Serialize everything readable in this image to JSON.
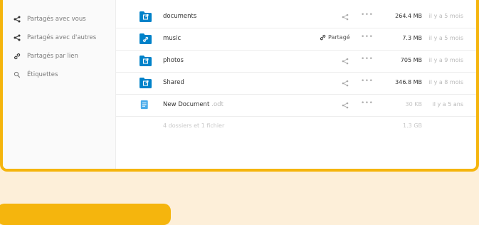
{
  "sidebar": {
    "items": [
      {
        "label": "Partagés avec vous",
        "icon": "share-icon"
      },
      {
        "label": "Partagés avec d'autres",
        "icon": "share-icon"
      },
      {
        "label": "Partagés par lien",
        "icon": "link-icon"
      },
      {
        "label": "Étiquettes",
        "icon": "tag-search-icon"
      }
    ]
  },
  "files": [
    {
      "name": "documents",
      "ext": "",
      "icon": "folder-external-icon",
      "shared_label": "",
      "size": "264.4 MB",
      "modified": "il y a 5 mois"
    },
    {
      "name": "music",
      "ext": "",
      "icon": "folder-link-icon",
      "shared_label": "Partagé",
      "size": "7.3 MB",
      "modified": "il y a 5 mois"
    },
    {
      "name": "photos",
      "ext": "",
      "icon": "folder-external-icon",
      "shared_label": "",
      "size": "705 MB",
      "modified": "il y a 9 mois"
    },
    {
      "name": "Shared",
      "ext": "",
      "icon": "folder-external-icon",
      "shared_label": "",
      "size": "346.8 MB",
      "modified": "il y a 8 mois"
    },
    {
      "name": "New Document",
      "ext": ".odt",
      "icon": "document-icon",
      "shared_label": "",
      "size": "30 KB",
      "modified": "il y a 5 ans"
    }
  ],
  "summary": {
    "text": "4 dossiers et 1 fichier",
    "size": "1.3 GB"
  },
  "colors": {
    "accent_border": "#f5b50d",
    "background": "#fdefd9",
    "folder_blue": "#0082c9"
  }
}
